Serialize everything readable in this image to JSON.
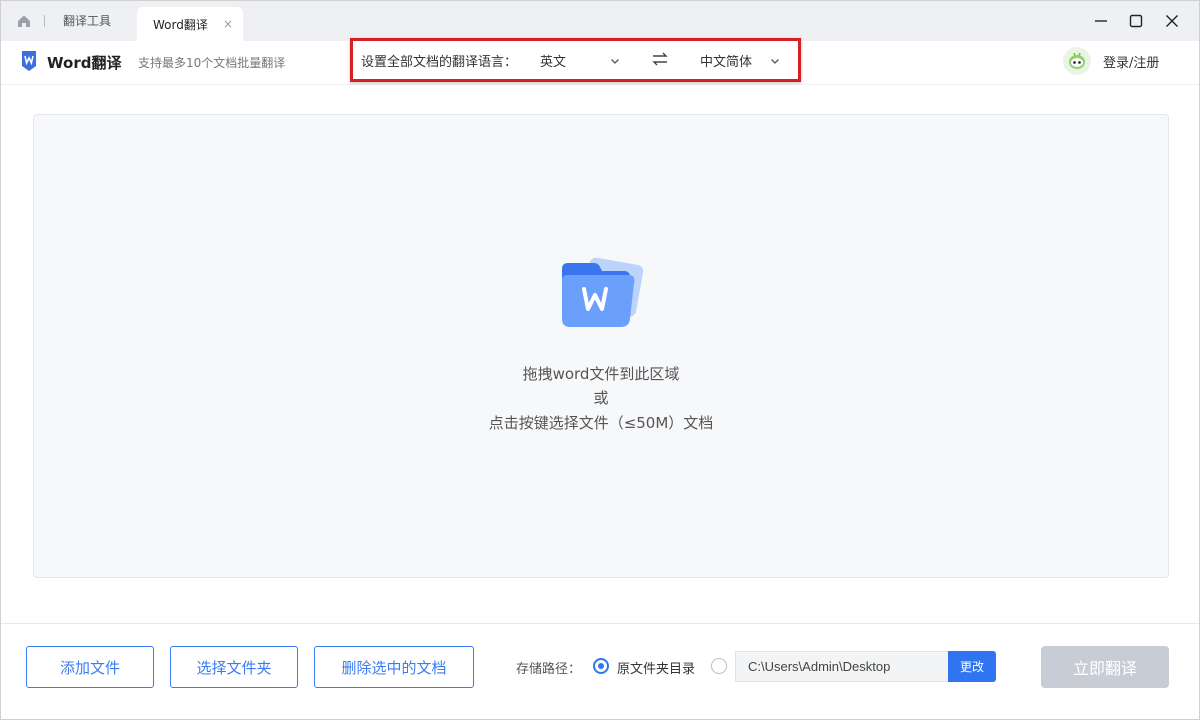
{
  "titlebar": {
    "home_icon": "home-icon",
    "tab_tools": "翻译工具",
    "tab_active": "Word翻译",
    "tab_close": "×"
  },
  "header": {
    "app_title": "Word翻译",
    "app_subtitle": "支持最多10个文档批量翻译",
    "lang_label": "设置全部文档的翻译语言：",
    "source_lang": "英文",
    "target_lang": "中文简体",
    "login": "登录/注册"
  },
  "dropzone": {
    "line1": "拖拽word文件到此区域",
    "line2": "或",
    "line3": "点击按键选择文件（≤50M）文档"
  },
  "bottom": {
    "add_file": "添加文件",
    "select_folder": "选择文件夹",
    "delete_selected": "删除选中的文档",
    "save_label": "存储路径：",
    "radio_original": "原文件夹目录",
    "path_value": "C:\\Users\\Admin\\Desktop",
    "change": "更改",
    "translate": "立即翻译"
  },
  "colors": {
    "accent": "#2f74f0",
    "highlight_border": "#d61f26",
    "disabled_button": "#c8cdd5"
  }
}
